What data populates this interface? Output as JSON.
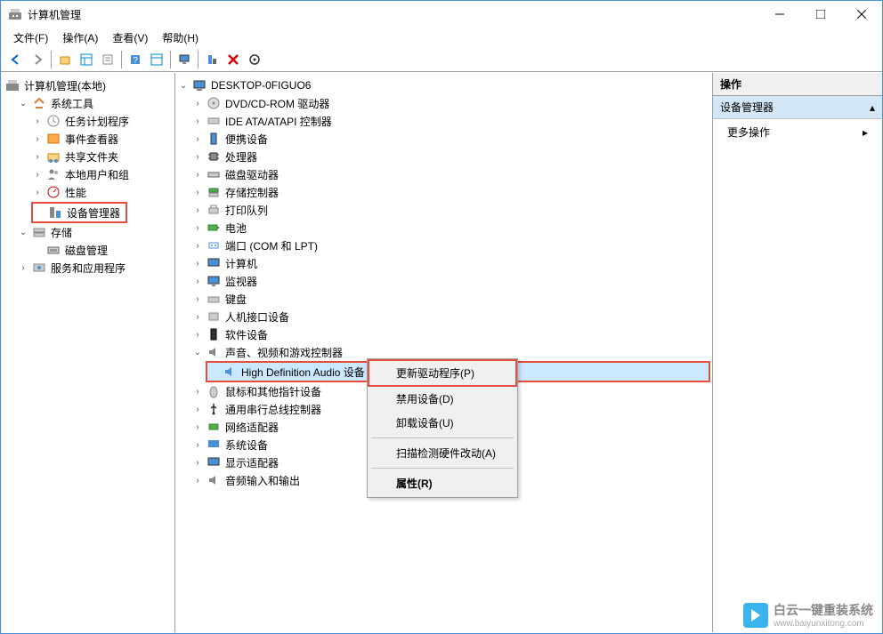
{
  "window": {
    "title": "计算机管理"
  },
  "menu": {
    "file": "文件(F)",
    "action": "操作(A)",
    "view": "查看(V)",
    "help": "帮助(H)"
  },
  "left_tree": {
    "root": "计算机管理(本地)",
    "system_tools": "系统工具",
    "task_scheduler": "任务计划程序",
    "event_viewer": "事件查看器",
    "shared_folders": "共享文件夹",
    "local_users": "本地用户和组",
    "performance": "性能",
    "device_manager": "设备管理器",
    "storage": "存储",
    "disk_mgmt": "磁盘管理",
    "services_apps": "服务和应用程序"
  },
  "center_tree": {
    "root": "DESKTOP-0FIGUO6",
    "dvd": "DVD/CD-ROM 驱动器",
    "ide": "IDE ATA/ATAPI 控制器",
    "portable": "便携设备",
    "cpu": "处理器",
    "disk_drives": "磁盘驱动器",
    "storage_ctrl": "存储控制器",
    "print_queue": "打印队列",
    "battery": "电池",
    "ports": "端口 (COM 和 LPT)",
    "computer": "计算机",
    "monitor": "监视器",
    "keyboard": "键盘",
    "hid": "人机接口设备",
    "software": "软件设备",
    "audio": "声音、视频和游戏控制器",
    "hd_audio": "High Definition Audio 设备",
    "mouse": "鼠标和其他指针设备",
    "usb": "通用串行总线控制器",
    "network": "网络适配器",
    "system_dev": "系统设备",
    "display": "显示适配器",
    "audio_io": "音频输入和输出"
  },
  "context_menu": {
    "update_driver": "更新驱动程序(P)",
    "disable": "禁用设备(D)",
    "uninstall": "卸载设备(U)",
    "scan": "扫描检测硬件改动(A)",
    "properties": "属性(R)"
  },
  "right_panel": {
    "header": "操作",
    "section": "设备管理器",
    "more": "更多操作"
  },
  "watermark": {
    "text": "白云一键重装系统",
    "url": "www.baiyunxitong.com"
  }
}
